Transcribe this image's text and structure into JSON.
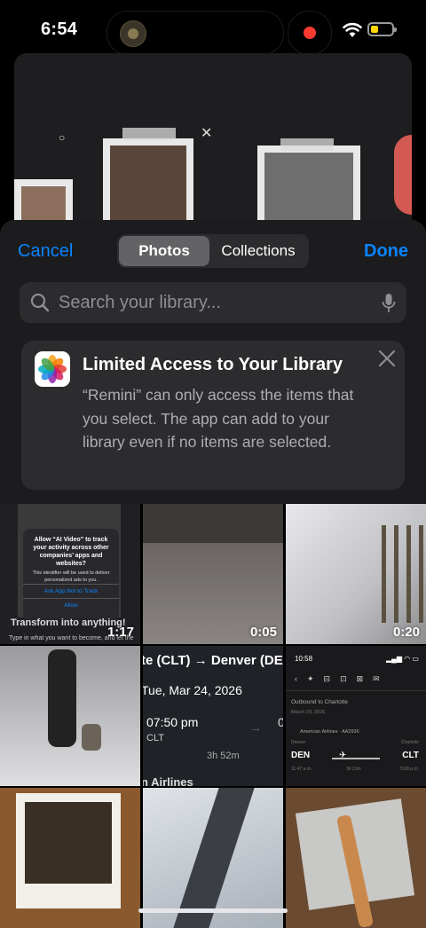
{
  "status_bar": {
    "time": "6:54",
    "battery_level_percent": 35
  },
  "picker": {
    "cancel_label": "Cancel",
    "done_label": "Done",
    "segments": [
      "Photos",
      "Collections"
    ],
    "selected_segment": "Photos",
    "search_placeholder": "Search your library...",
    "banner": {
      "title": "Limited Access to Your Library",
      "body": "“Remini” can only access the items that you select. The app can add to your library even if no items are selected."
    }
  },
  "grid": {
    "durations": [
      "1:17",
      "0:05",
      "0:20"
    ],
    "att_prompt": {
      "title": "Allow “AI Video” to track your activity across other companies’ apps and websites?",
      "body": "This identifier will be used to deliver personalized ads to you.",
      "deny": "Ask App Not to Track",
      "allow": "Allow",
      "headline": "Transform into anything!",
      "caption": "Type in what you want to become, and let the"
    },
    "flight": {
      "route": "te (CLT) → Denver (DE",
      "date": "Tue, Mar 24, 2026",
      "time": "07:50 pm",
      "origin_code": "CLT",
      "duration": "3h 52m",
      "airline": "n Airlines",
      "arrival_digit": "0"
    },
    "flight_screenshot": {
      "time": "10:58",
      "outbound": "Outbound to Charlotte",
      "date": "March 29, 2026",
      "airline": "American Airlines · AA2936",
      "origin": "DEN",
      "destination": "CLT",
      "origin_city": "Denver",
      "destination_city": "Charlotte",
      "dep_time": "11:47 a.m.",
      "flight_length": "3h 21m",
      "arr_time": "5:08 p.m."
    }
  },
  "colors": {
    "accent": "#0a84ff",
    "sheet": "#1c1c1e",
    "record": "#ff3b30",
    "battery": "#ffd60a"
  }
}
